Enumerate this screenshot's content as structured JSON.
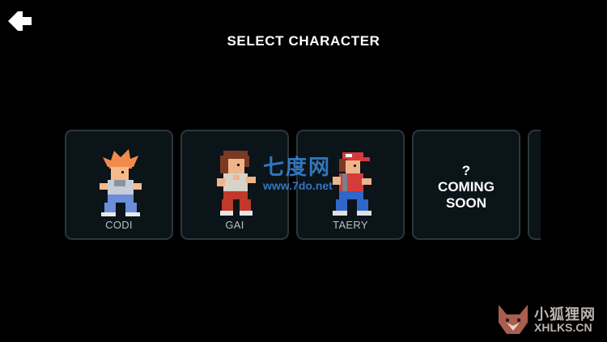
{
  "header": {
    "title": "SELECT CHARACTER",
    "back_icon": "arrow-left-icon"
  },
  "characters": [
    {
      "name": "CODI",
      "hair": "#f28a4c",
      "skin": "#f6b98a",
      "shirt": "#c7ccd6",
      "pants": "#6a8fd8",
      "available": true
    },
    {
      "name": "GAI",
      "hair": "#7a3a22",
      "skin": "#f0b48a",
      "shirt": "#d9d2c8",
      "pants": "#c0392b",
      "available": true
    },
    {
      "name": "TAERY",
      "hair": "#7a3a22",
      "skin": "#f0b48a",
      "shirt": "#d63b3b",
      "pants": "#2f66c9",
      "available": true
    }
  ],
  "locked_card": {
    "symbol": "?",
    "line1": "COMING",
    "line2": "SOON"
  },
  "colors": {
    "background": "#000000",
    "card_bg": "#0b1419",
    "card_border": "#2c363b",
    "name_text": "#b9c0c4"
  },
  "watermarks": {
    "center_main": "七度网",
    "center_url": "www.7do.net",
    "corner_main": "小狐狸网",
    "corner_url": "XHLKS.CN"
  }
}
